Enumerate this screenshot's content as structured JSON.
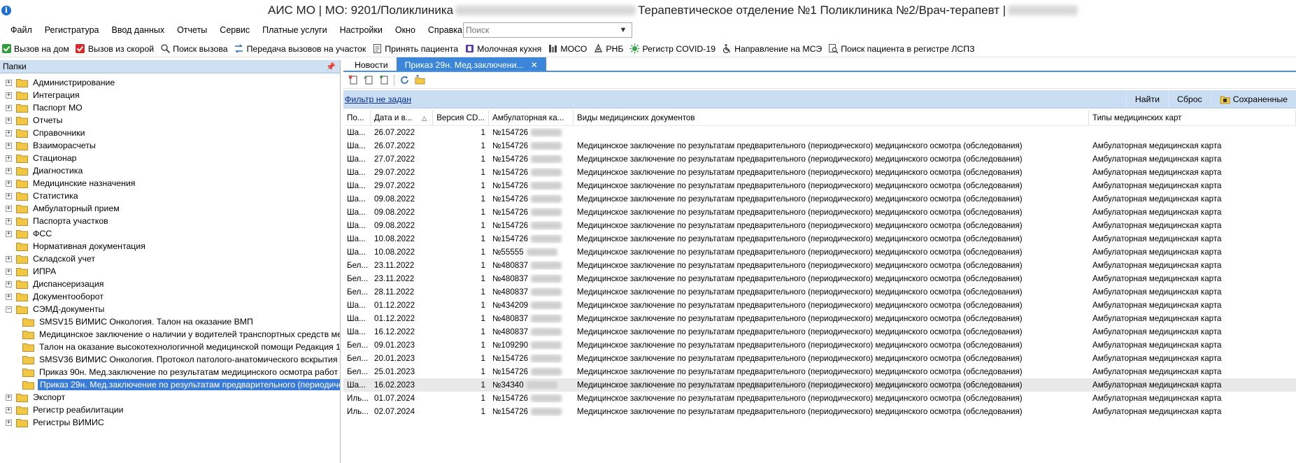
{
  "window": {
    "title_start": "АИС МО | МО: 9201/Поликлиника",
    "title_end": "Терапевтическое отделение №1 Поликлиника №2/Врач-терапевт |"
  },
  "menu": [
    "Файл",
    "Регистратура",
    "Ввод данных",
    "Отчеты",
    "Сервис",
    "Платные услуги",
    "Настройки",
    "Окно",
    "Справка"
  ],
  "search": {
    "placeholder": "Поиск"
  },
  "toolbar": [
    {
      "label": "Вызов на дом",
      "icon": "home-call-icon"
    },
    {
      "label": "Вызов из скорой",
      "icon": "ambulance-icon"
    },
    {
      "label": "Поиск вызова",
      "icon": "search-icon"
    },
    {
      "label": "Передача вызовов на участок",
      "icon": "transfer-icon"
    },
    {
      "label": "Принять пациента",
      "icon": "document-icon"
    },
    {
      "label": "Молочная кухня",
      "icon": "bottle-icon"
    },
    {
      "label": "МОСО",
      "icon": "moso-icon"
    },
    {
      "label": "РНБ",
      "icon": "rnb-icon"
    },
    {
      "label": "Регистр COVID-19",
      "icon": "virus-icon"
    },
    {
      "label": "Направление на МСЭ",
      "icon": "wheelchair-icon"
    },
    {
      "label": "Поиск пациента в регистре ЛСПЗ",
      "icon": "search-document-icon"
    }
  ],
  "left_panel": {
    "header": "Папки",
    "tree": [
      {
        "label": "Администрирование",
        "level": 0,
        "expander": "+"
      },
      {
        "label": "Интеграция",
        "level": 0,
        "expander": "+"
      },
      {
        "label": "Паспорт МО",
        "level": 0,
        "expander": "+"
      },
      {
        "label": "Отчеты",
        "level": 0,
        "expander": "+"
      },
      {
        "label": "Справочники",
        "level": 0,
        "expander": "+"
      },
      {
        "label": "Взаиморасчеты",
        "level": 0,
        "expander": "+"
      },
      {
        "label": "Стационар",
        "level": 0,
        "expander": "+"
      },
      {
        "label": "Диагностика",
        "level": 0,
        "expander": "+"
      },
      {
        "label": "Медицинские назначения",
        "level": 0,
        "expander": "+"
      },
      {
        "label": "Статистика",
        "level": 0,
        "expander": "+"
      },
      {
        "label": "Амбулаторный прием",
        "level": 0,
        "expander": "+"
      },
      {
        "label": "Паспорта участков",
        "level": 0,
        "expander": "+"
      },
      {
        "label": "ФСС",
        "level": 0,
        "expander": "+"
      },
      {
        "label": "Нормативная документация",
        "level": 0,
        "expander": ""
      },
      {
        "label": "Складской учет",
        "level": 0,
        "expander": "+"
      },
      {
        "label": "ИПРА",
        "level": 0,
        "expander": "+"
      },
      {
        "label": "Диспансеризация",
        "level": 0,
        "expander": "+"
      },
      {
        "label": "Документооборот",
        "level": 0,
        "expander": "+"
      },
      {
        "label": "СЭМД-документы",
        "level": 0,
        "expander": "−"
      },
      {
        "label": "SMSV15 ВИМИС Онкология. Талон на оказание ВМП",
        "level": 1,
        "expander": ""
      },
      {
        "label": "Медицинское заключение о наличии у водителей транспортных средств ме",
        "level": 1,
        "expander": ""
      },
      {
        "label": "Талон на оказание высокотехнологичной медицинской помощи Редакция 1",
        "level": 1,
        "expander": ""
      },
      {
        "label": "SMSV36 ВИМИС Онкология. Протокол патолого-анатомического вскрытия",
        "level": 1,
        "expander": ""
      },
      {
        "label": "Приказ 90н. Мед.заключение по результатам медицинского осмотра работ",
        "level": 1,
        "expander": ""
      },
      {
        "label": "Приказ 29н. Мед.заключение по результатам предварительного (периодиче",
        "level": 1,
        "expander": "",
        "selected": true
      },
      {
        "label": "Экспорт",
        "level": 0,
        "expander": "+"
      },
      {
        "label": "Регистр реабилитации",
        "level": 0,
        "expander": "+"
      },
      {
        "label": "Регистры ВИМИС",
        "level": 0,
        "expander": "+"
      }
    ]
  },
  "tabs": [
    {
      "label": "Новости",
      "active": false
    },
    {
      "label": "Приказ 29н. Мед.заключени...",
      "active": true
    }
  ],
  "filter": {
    "link": "Фильтр не задан",
    "find": "Найти",
    "reset": "Сброс",
    "saved": "Сохраненные"
  },
  "grid": {
    "columns": [
      "По...",
      "Дата и в...",
      "Версия CD...",
      "Амбулаторная ка...",
      "Виды медицинских документов",
      "Типы медицинских карт"
    ],
    "rows": [
      {
        "po": "Ша...",
        "date": "26.07.2022",
        "ver": "1",
        "amb": "№154726",
        "kind": "",
        "type": ""
      },
      {
        "po": "Ша...",
        "date": "26.07.2022",
        "ver": "1",
        "amb": "№154726",
        "kind": "Медицинское заключение по результатам предварительного (периодического) медицинского осмотра (обследования)",
        "type": "Амбулаторная медицинская карта"
      },
      {
        "po": "Ша...",
        "date": "27.07.2022",
        "ver": "1",
        "amb": "№154726",
        "kind": "Медицинское заключение по результатам предварительного (периодического) медицинского осмотра (обследования)",
        "type": "Амбулаторная медицинская карта"
      },
      {
        "po": "Ша...",
        "date": "29.07.2022",
        "ver": "1",
        "amb": "№154726",
        "kind": "Медицинское заключение по результатам предварительного (периодического) медицинского осмотра (обследования)",
        "type": "Амбулаторная медицинская карта"
      },
      {
        "po": "Ша...",
        "date": "29.07.2022",
        "ver": "1",
        "amb": "№154726",
        "kind": "Медицинское заключение по результатам предварительного (периодического) медицинского осмотра (обследования)",
        "type": "Амбулаторная медицинская карта"
      },
      {
        "po": "Ша...",
        "date": "09.08.2022",
        "ver": "1",
        "amb": "№154726",
        "kind": "Медицинское заключение по результатам предварительного (периодического) медицинского осмотра (обследования)",
        "type": "Амбулаторная медицинская карта"
      },
      {
        "po": "Ша...",
        "date": "09.08.2022",
        "ver": "1",
        "amb": "№154726",
        "kind": "Медицинское заключение по результатам предварительного (периодического) медицинского осмотра (обследования)",
        "type": "Амбулаторная медицинская карта"
      },
      {
        "po": "Ша...",
        "date": "09.08.2022",
        "ver": "1",
        "amb": "№154726",
        "kind": "Медицинское заключение по результатам предварительного (периодического) медицинского осмотра (обследования)",
        "type": "Амбулаторная медицинская карта"
      },
      {
        "po": "Ша...",
        "date": "10.08.2022",
        "ver": "1",
        "amb": "№154726",
        "kind": "Медицинское заключение по результатам предварительного (периодического) медицинского осмотра (обследования)",
        "type": "Амбулаторная медицинская карта"
      },
      {
        "po": "Ша...",
        "date": "10.08.2022",
        "ver": "1",
        "amb": "№55555",
        "kind": "Медицинское заключение по результатам предварительного (периодического) медицинского осмотра (обследования)",
        "type": "Амбулаторная медицинская карта"
      },
      {
        "po": "Бел...",
        "date": "23.11.2022",
        "ver": "1",
        "amb": "№480837",
        "kind": "Медицинское заключение по результатам предварительного (периодического) медицинского осмотра (обследования)",
        "type": "Амбулаторная медицинская карта"
      },
      {
        "po": "Бел...",
        "date": "23.11.2022",
        "ver": "1",
        "amb": "№480837",
        "kind": "Медицинское заключение по результатам предварительного (периодического) медицинского осмотра (обследования)",
        "type": "Амбулаторная медицинская карта"
      },
      {
        "po": "Бел...",
        "date": "28.11.2022",
        "ver": "1",
        "amb": "№480837",
        "kind": "Медицинское заключение по результатам предварительного (периодического) медицинского осмотра (обследования)",
        "type": "Амбулаторная медицинская карта"
      },
      {
        "po": "Ша...",
        "date": "01.12.2022",
        "ver": "1",
        "amb": "№434209",
        "kind": "Медицинское заключение по результатам предварительного (периодического) медицинского осмотра (обследования)",
        "type": "Амбулаторная медицинская карта"
      },
      {
        "po": "Ша...",
        "date": "01.12.2022",
        "ver": "1",
        "amb": "№480837",
        "kind": "Медицинское заключение по результатам предварительного (периодического) медицинского осмотра (обследования)",
        "type": "Амбулаторная медицинская карта"
      },
      {
        "po": "Ша...",
        "date": "16.12.2022",
        "ver": "1",
        "amb": "№480837",
        "kind": "Медицинское заключение по результатам предварительного (периодического) медицинского осмотра (обследования)",
        "type": "Амбулаторная медицинская карта"
      },
      {
        "po": "Бел...",
        "date": "09.01.2023",
        "ver": "1",
        "amb": "№109290",
        "kind": "Медицинское заключение по результатам предварительного (периодического) медицинского осмотра (обследования)",
        "type": "Амбулаторная медицинская карта"
      },
      {
        "po": "Бел...",
        "date": "20.01.2023",
        "ver": "1",
        "amb": "№154726",
        "kind": "Медицинское заключение по результатам предварительного (периодического) медицинского осмотра (обследования)",
        "type": "Амбулаторная медицинская карта"
      },
      {
        "po": "Бел...",
        "date": "25.01.2023",
        "ver": "1",
        "amb": "№154726",
        "kind": "Медицинское заключение по результатам предварительного (периодического) медицинского осмотра (обследования)",
        "type": "Амбулаторная медицинская карта"
      },
      {
        "po": "Ша...",
        "date": "16.02.2023",
        "ver": "1",
        "amb": "№34340",
        "kind": "Медицинское заключение по результатам предварительного (периодического) медицинского осмотра (обследования)",
        "type": "Амбулаторная медицинская карта",
        "highlight": true
      },
      {
        "po": "Иль...",
        "date": "01.07.2024",
        "ver": "1",
        "amb": "№154726",
        "kind": "Медицинское заключение по результатам предварительного (периодического) медицинского осмотра (обследования)",
        "type": "Амбулаторная медицинская карта"
      },
      {
        "po": "Иль...",
        "date": "02.07.2024",
        "ver": "1",
        "amb": "№154726",
        "kind": "Медицинское заключение по результатам предварительного (периодического) медицинского осмотра (обследования)",
        "type": "Амбулаторная медицинская карта"
      }
    ]
  },
  "colors": {
    "accent": "#3b86d8",
    "panel_header": "#cfe0f3",
    "filter_bar": "#c9ddf3",
    "selection": "#3b7bd8",
    "folder": "#f2c744"
  }
}
